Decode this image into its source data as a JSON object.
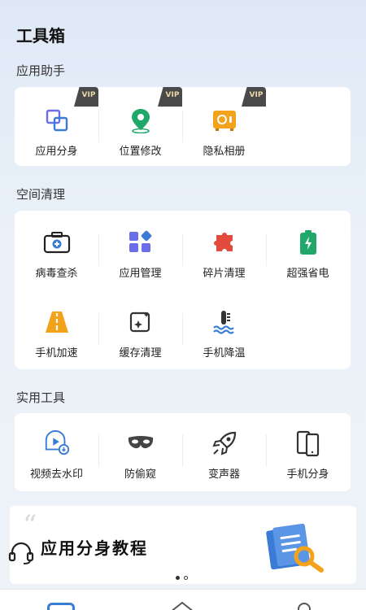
{
  "page_title": "工具箱",
  "sections": {
    "app_assistant": {
      "title": "应用助手",
      "items": [
        {
          "label": "应用分身",
          "badge": "VIP"
        },
        {
          "label": "位置修改",
          "badge": "VIP"
        },
        {
          "label": "隐私相册",
          "badge": "VIP"
        }
      ]
    },
    "space_clean": {
      "title": "空间清理",
      "items": [
        {
          "label": "病毒查杀"
        },
        {
          "label": "应用管理"
        },
        {
          "label": "碎片清理"
        },
        {
          "label": "超强省电"
        },
        {
          "label": "手机加速"
        },
        {
          "label": "缓存清理"
        },
        {
          "label": "手机降温"
        }
      ]
    },
    "utilities": {
      "title": "实用工具",
      "items": [
        {
          "label": "视频去水印"
        },
        {
          "label": "防偷窥"
        },
        {
          "label": "变声器"
        },
        {
          "label": "手机分身"
        }
      ]
    }
  },
  "banner": {
    "quote_mark": "“",
    "text": "应用分身教程",
    "page_index": 0,
    "page_count": 2
  },
  "colors": {
    "accent_blue": "#3a7bd5",
    "green": "#1fa86a",
    "orange": "#f2a31b",
    "red": "#e24a3b",
    "purple": "#6a6ee8"
  }
}
